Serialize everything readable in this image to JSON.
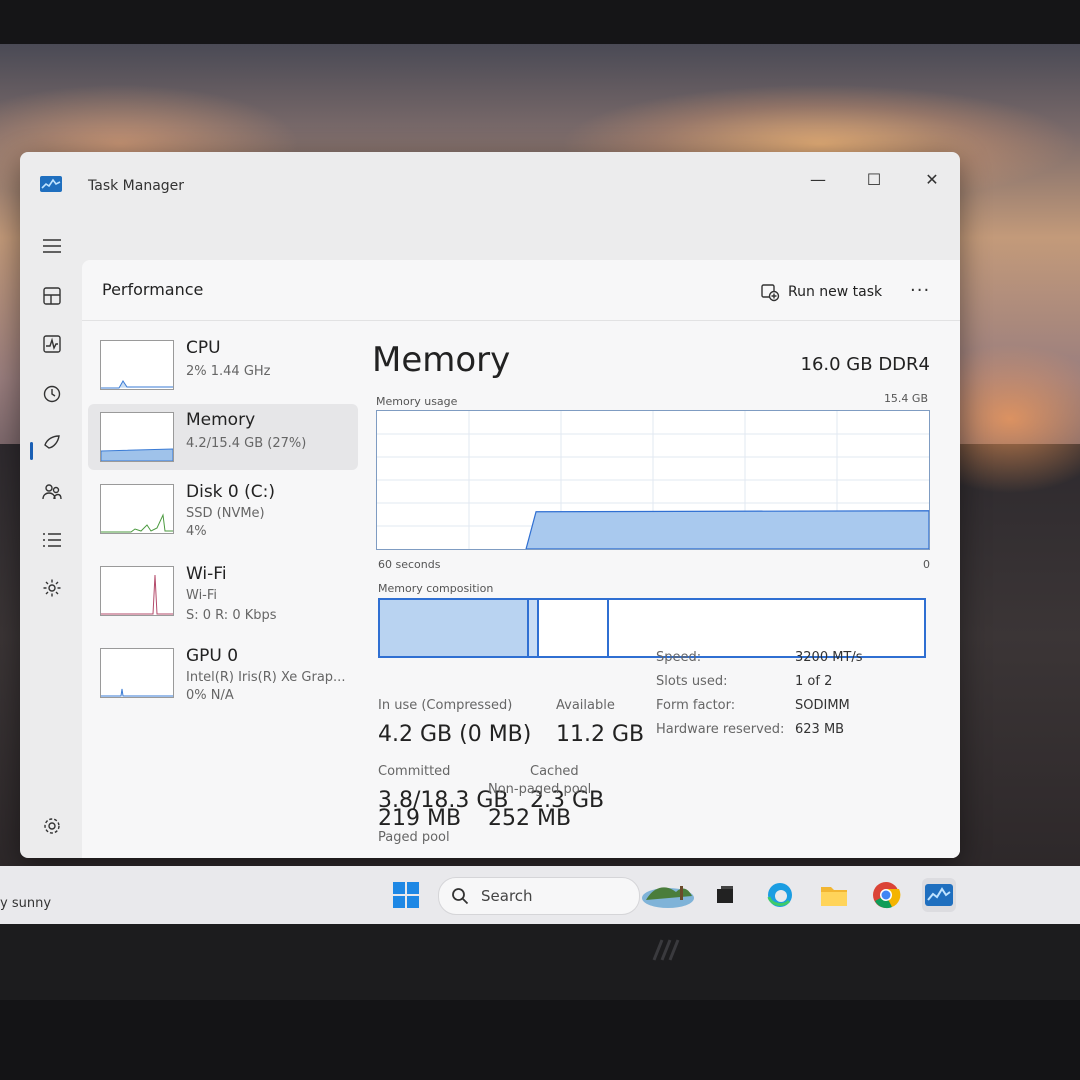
{
  "window": {
    "title": "Task Manager",
    "controls": {
      "minimize": "—",
      "maximize": "☐",
      "close": "✕"
    }
  },
  "header": {
    "title": "Performance",
    "run_new_task": "Run new task",
    "more": "···"
  },
  "sidebar": {
    "items": [
      {
        "name": "CPU",
        "sub1": "2% 1.44 GHz",
        "sub2": "",
        "sub3": ""
      },
      {
        "name": "Memory",
        "sub1": "4.2/15.4 GB (27%)",
        "sub2": "",
        "sub3": ""
      },
      {
        "name": "Disk 0 (C:)",
        "sub1": "SSD (NVMe)",
        "sub2": "4%",
        "sub3": ""
      },
      {
        "name": "Wi-Fi",
        "sub1": "Wi-Fi",
        "sub2": "S: 0 R: 0 Kbps",
        "sub3": ""
      },
      {
        "name": "GPU 0",
        "sub1": "Intel(R) Iris(R) Xe Grap...",
        "sub2": "0% N/A",
        "sub3": ""
      }
    ]
  },
  "memory": {
    "title": "Memory",
    "spec": "16.0 GB DDR4",
    "usage_label": "Memory usage",
    "usage_max": "15.4 GB",
    "axis_left": "60 seconds",
    "axis_right": "0",
    "usage_level_fraction": 0.27,
    "composition_label": "Memory composition",
    "stats": {
      "in_use_label": "In use (Compressed)",
      "in_use_value": "4.2 GB (0 MB)",
      "available_label": "Available",
      "available_value": "11.2 GB",
      "committed_label": "Committed",
      "committed_value": "3.8/18.3 GB",
      "cached_label": "Cached",
      "cached_value": "2.3 GB",
      "paged_label": "Paged pool",
      "paged_value": "219 MB",
      "nonpaged_label": "Non-paged pool",
      "nonpaged_value": "252 MB"
    },
    "specs": {
      "speed_label": "Speed:",
      "speed_value": "3200 MT/s",
      "slots_label": "Slots used:",
      "slots_value": "1 of 2",
      "form_label": "Form factor:",
      "form_value": "SODIMM",
      "hw_label": "Hardware reserved:",
      "hw_value": "623 MB"
    }
  },
  "taskbar": {
    "weather_text": "y sunny",
    "search_placeholder": "Search"
  },
  "colors": {
    "accent": "#2f6fd2",
    "graph_fill": "#b9d3f1",
    "window_bg": "#ececed"
  }
}
